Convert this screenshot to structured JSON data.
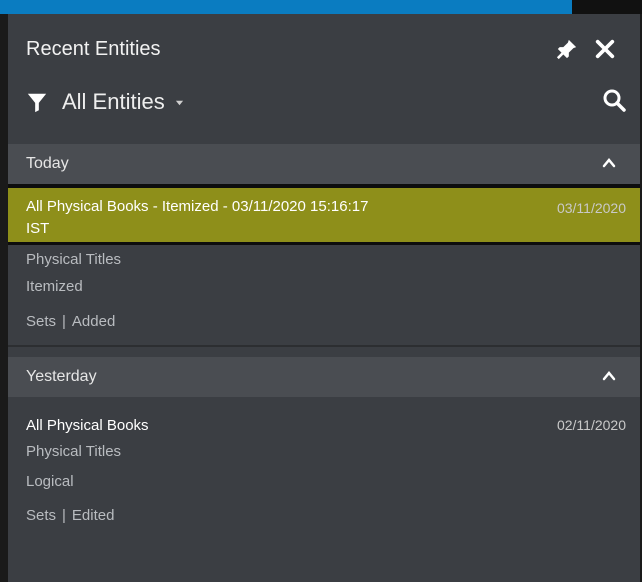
{
  "panel": {
    "title": "Recent Entities",
    "filter_label": "All Entities",
    "colors": {
      "panel_bg": "#3b3e43",
      "section_bg": "#4a4d52",
      "highlight_bg": "#8e8f1a",
      "top_strip": "#0a7cc1"
    }
  },
  "icons": {
    "pin": "pin-icon",
    "close": "close-icon",
    "filter": "filter-icon",
    "dropdown": "chevron-down-icon",
    "search": "search-icon",
    "collapse": "chevron-up-icon"
  },
  "sections": [
    {
      "label": "Today",
      "items": [
        {
          "title_line1": "All Physical Books - Itemized - 03/11/2020 15:16:17",
          "title_line2": "IST",
          "date": "03/11/2020",
          "type": "Physical Titles",
          "subtype": "Itemized",
          "category": "Sets",
          "action": "Added",
          "separator": "|"
        }
      ]
    },
    {
      "label": "Yesterday",
      "items": [
        {
          "title_line1": "All Physical Books",
          "date": "02/11/2020",
          "type": "Physical Titles",
          "subtype": "Logical",
          "category": "Sets",
          "action": "Edited",
          "separator": "|"
        }
      ]
    }
  ]
}
